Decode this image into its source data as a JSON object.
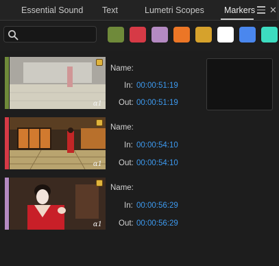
{
  "tabs": [
    {
      "label": "Essential Sound",
      "active": false
    },
    {
      "label": "Text",
      "active": false
    },
    {
      "label": "Lumetri Scopes",
      "active": false
    },
    {
      "label": "Markers",
      "active": true
    }
  ],
  "search": {
    "value": "",
    "placeholder": ""
  },
  "color_filters": [
    {
      "name": "green",
      "color": "#6f8a3a"
    },
    {
      "name": "red",
      "color": "#d63a46"
    },
    {
      "name": "lavender",
      "color": "#b48ac2"
    },
    {
      "name": "orange",
      "color": "#ec7626"
    },
    {
      "name": "yellow",
      "color": "#d6a22c"
    },
    {
      "name": "white",
      "color": "#ffffff"
    },
    {
      "name": "blue",
      "color": "#4a87ee"
    },
    {
      "name": "cyan",
      "color": "#3ddcc0"
    }
  ],
  "markers": [
    {
      "color": "#6f8a3a",
      "name_label": "Name:",
      "in_label": "In:",
      "out_label": "Out:",
      "in": "00:00:51:19",
      "out": "00:00:51:19",
      "alpha": "α1",
      "selected": true
    },
    {
      "color": "#d63a46",
      "name_label": "Name:",
      "in_label": "In:",
      "out_label": "Out:",
      "in": "00:00:54:10",
      "out": "00:00:54:10",
      "alpha": "α1",
      "selected": false
    },
    {
      "color": "#b48ac2",
      "name_label": "Name:",
      "in_label": "In:",
      "out_label": "Out:",
      "in": "00:00:56:29",
      "out": "00:00:56:29",
      "alpha": "α1",
      "selected": false
    }
  ]
}
